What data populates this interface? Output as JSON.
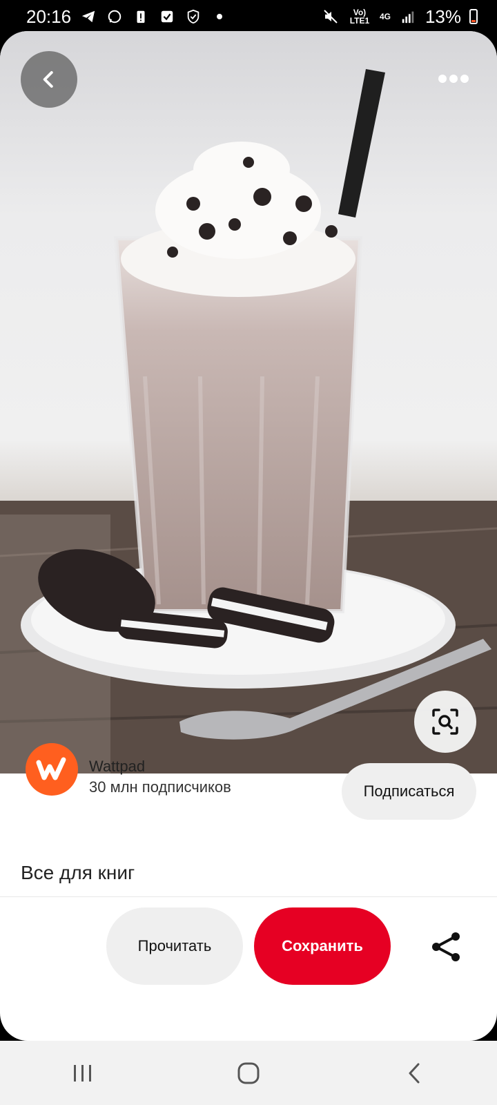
{
  "status_bar": {
    "time": "20:16",
    "battery_percent": "13%",
    "net_label": "Vo) LTE1",
    "net_type": "4G",
    "icons": [
      "telegram-icon",
      "whatsapp-icon",
      "battery-alert-icon",
      "check-box-icon",
      "shield-icon",
      "dot-icon",
      "mute-icon",
      "signal-icon",
      "battery-icon"
    ]
  },
  "pin": {
    "image_description_icon": "milkshake-photo",
    "back_icon": "chevron-left-icon",
    "more_icon": "more-horizontal-icon",
    "lens_icon": "visual-search-icon"
  },
  "creator": {
    "name": "Wattpad",
    "subscribers": "30 млн подписчиков",
    "follow_label": "Подписаться",
    "avatar_letter": "w",
    "brand_color": "#ff5f1f"
  },
  "board": {
    "title": "Все для книг"
  },
  "actions": {
    "read_label": "Прочитать",
    "save_label": "Сохранить",
    "save_color": "#e60023",
    "share_icon": "share-icon"
  },
  "nav": {
    "items": [
      "recent-apps-icon",
      "home-icon",
      "back-icon"
    ]
  }
}
